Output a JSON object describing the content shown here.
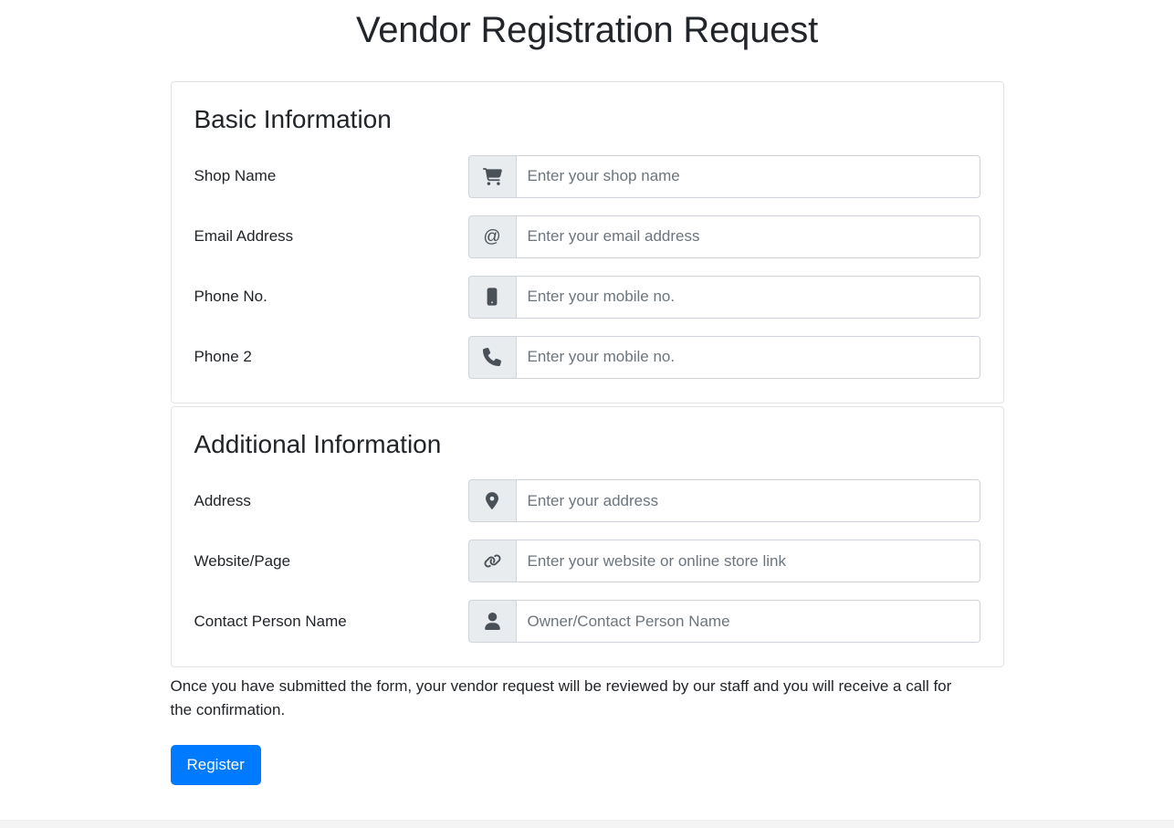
{
  "page": {
    "title": "Vendor Registration Request"
  },
  "colors": {
    "primary_button": "#007bff",
    "input_prefix_bg": "#e9ecef",
    "input_border": "#ced4da",
    "card_border": "#e3e3e3",
    "placeholder_text": "#6c757d",
    "body_text": "#212529",
    "icon": "#495057"
  },
  "sections": [
    {
      "heading": "Basic Information",
      "fields": [
        {
          "label": "Shop Name",
          "placeholder": "Enter your shop name",
          "value": "",
          "icon": "shopping-cart-icon",
          "name": "shop-name"
        },
        {
          "label": "Email Address",
          "placeholder": "Enter your email address",
          "value": "",
          "icon": "at-sign-icon",
          "name": "email-address"
        },
        {
          "label": "Phone No.",
          "placeholder": "Enter your mobile no.",
          "value": "",
          "icon": "mobile-phone-icon",
          "name": "phone-no"
        },
        {
          "label": "Phone 2",
          "placeholder": "Enter your mobile no.",
          "value": "",
          "icon": "telephone-handset-icon",
          "name": "phone-2"
        }
      ]
    },
    {
      "heading": "Additional Information",
      "fields": [
        {
          "label": "Address",
          "placeholder": "Enter your address",
          "value": "",
          "icon": "map-pin-icon",
          "name": "address"
        },
        {
          "label": "Website/Page",
          "placeholder": "Enter your website or online store link",
          "value": "",
          "icon": "link-chain-icon",
          "name": "website-page"
        },
        {
          "label": "Contact Person Name",
          "placeholder": "Owner/Contact Person Name",
          "value": "",
          "icon": "user-person-icon",
          "name": "contact-person-name"
        }
      ]
    }
  ],
  "footer": {
    "note": "Once you have submitted the form, your vendor request will be reviewed by our staff and you will receive a call for the confirmation.",
    "submit_label": "Register"
  }
}
